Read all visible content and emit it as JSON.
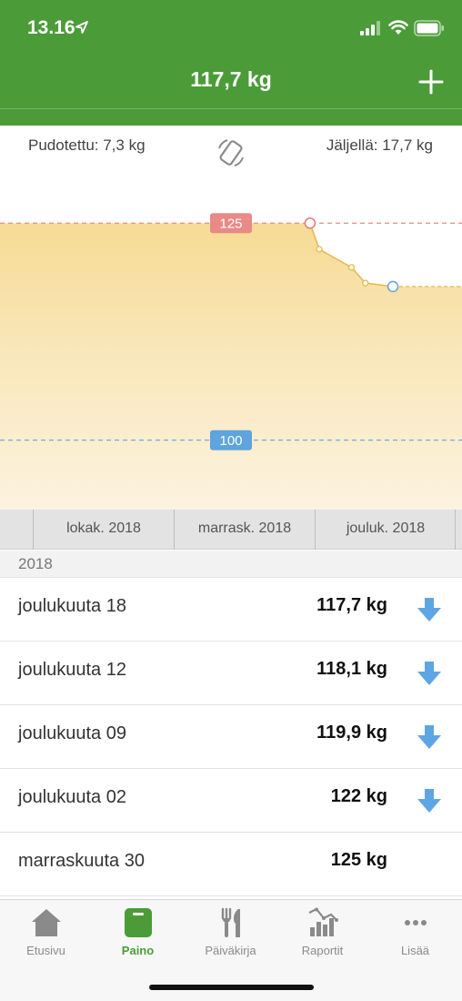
{
  "status_bar": {
    "time": "13.16"
  },
  "header": {
    "title": "117,7 kg",
    "add_icon": "plus-icon"
  },
  "stats": {
    "lost": "Pudotettu: 7,3 kg",
    "remaining": "Jäljellä: 17,7 kg",
    "rotate_icon": "rotate-device-icon"
  },
  "colors": {
    "brand": "#4b9c38",
    "start_line": "#e88a86",
    "goal_line": "#5ea4de",
    "area_fill": "#f6d98f",
    "trend_arrow": "#5ea6e3"
  },
  "chart_data": {
    "type": "area",
    "x_labels": [
      "lokak. 2018",
      "marrask. 2018",
      "jouluk. 2018"
    ],
    "series": [
      {
        "points": [
          {
            "date": "2018-11-30",
            "weight": 125.0
          },
          {
            "date": "2018-12-02",
            "weight": 122.0
          },
          {
            "date": "2018-12-09",
            "weight": 119.9
          },
          {
            "date": "2018-12-12",
            "weight": 118.1
          },
          {
            "date": "2018-12-18",
            "weight": 117.7
          }
        ]
      }
    ],
    "reference_lines": [
      {
        "label": "125",
        "value": 125,
        "color": "#e88a86"
      },
      {
        "label": "100",
        "value": 100,
        "color": "#5ea4de"
      }
    ],
    "ylim": [
      92,
      131
    ]
  },
  "list": {
    "section": "2018",
    "entries": [
      {
        "date": "joulukuuta 18",
        "weight": "117,7 kg",
        "trend": "down"
      },
      {
        "date": "joulukuuta 12",
        "weight": "118,1 kg",
        "trend": "down"
      },
      {
        "date": "joulukuuta 09",
        "weight": "119,9 kg",
        "trend": "down"
      },
      {
        "date": "joulukuuta 02",
        "weight": "122 kg",
        "trend": "down"
      },
      {
        "date": "marraskuuta 30",
        "weight": "125 kg",
        "trend": "none"
      }
    ]
  },
  "tabs": [
    {
      "label": "Etusivu",
      "icon": "home-icon",
      "active": false
    },
    {
      "label": "Paino",
      "icon": "scale-icon",
      "active": true
    },
    {
      "label": "Päiväkirja",
      "icon": "fork-knife-icon",
      "active": false
    },
    {
      "label": "Raportit",
      "icon": "reports-icon",
      "active": false
    },
    {
      "label": "Lisää",
      "icon": "more-icon",
      "active": false
    }
  ]
}
